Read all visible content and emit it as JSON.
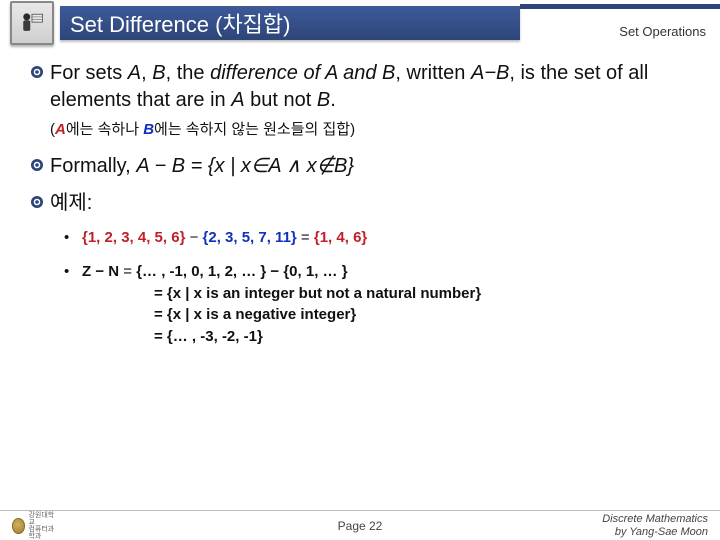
{
  "header": {
    "title": "Set Difference (차집합)",
    "subtitle": "Set Operations"
  },
  "body": {
    "definition_pre": "For sets ",
    "definition_A": "A",
    "definition_comma": ", ",
    "definition_B": "B",
    "definition_mid1": ", the ",
    "definition_term": "difference of A and B",
    "definition_mid2": ", written ",
    "definition_AminusB": "A−B",
    "definition_mid3": ", is the set of all elements that are in ",
    "definition_A2": "A",
    "definition_mid4": " but not ",
    "definition_B2": "B",
    "definition_end": ".",
    "paren": {
      "open": "(",
      "A": "A",
      "t1": "에는 속하나 ",
      "B": "B",
      "t2": "에는 속하지 않는 원소들의 집합)",
      "close": ""
    },
    "formal_pre": "Formally, ",
    "formal_expr": "A − B = {x | x∈A ∧ x∉B}",
    "examples_label": "예제:",
    "ex1": {
      "setA": "{1, 2, 3, 4, 5, 6}",
      "minus": " − ",
      "setB": "{2, 3, 5, 7, 11}",
      "eq": " = ",
      "result": "{1, 4, 6}"
    },
    "ex2": {
      "lhs": "Z − N",
      "eq0": " = ",
      "rhs0": "{… , -1, 0, 1, 2, … } − {0, 1, … }",
      "line1": "= {x | x is an integer but not a natural number}",
      "line2": "= {x | x is a negative integer}",
      "line3": "= {… , -3, -2, -1}"
    }
  },
  "footer": {
    "page": "Page 22",
    "credit1": "Discrete Mathematics",
    "credit2": "by Yang-Sae Moon"
  }
}
